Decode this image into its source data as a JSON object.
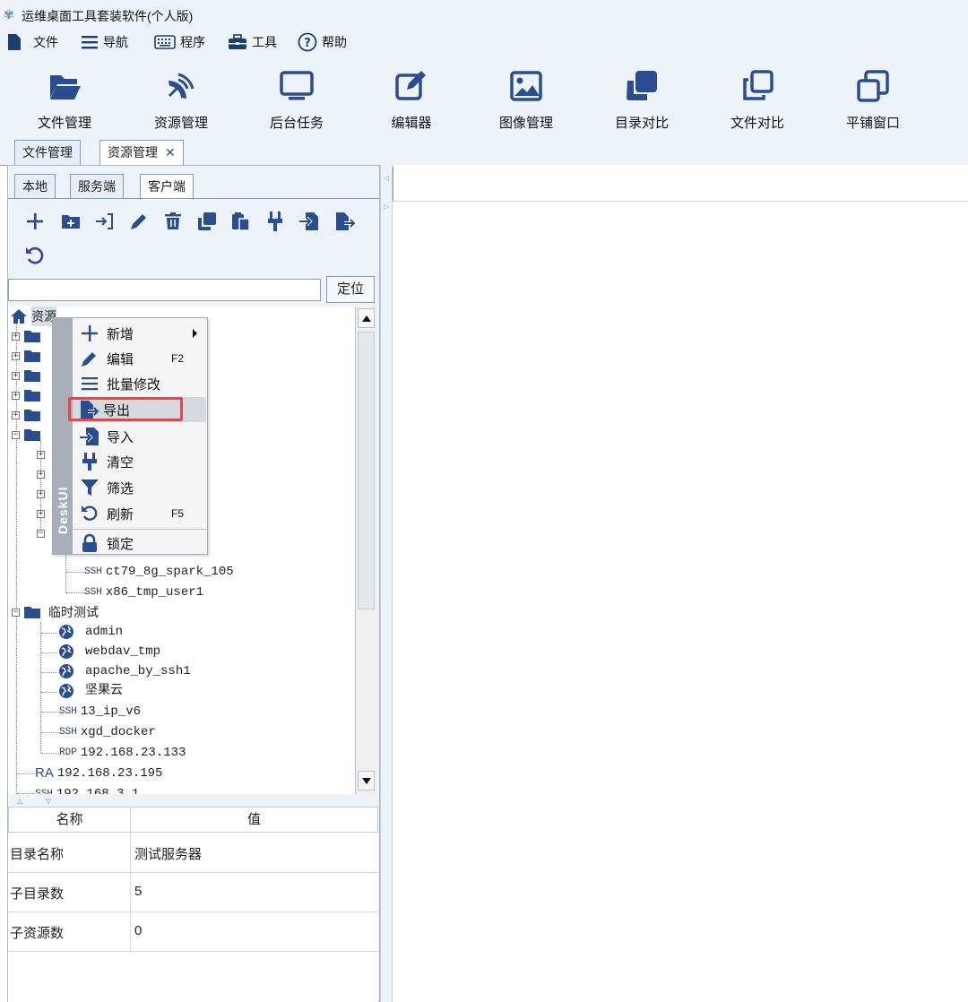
{
  "window": {
    "title": "运维桌面工具套装软件(个人版)"
  },
  "menubar": [
    {
      "label": "文件",
      "icon": "file-icon"
    },
    {
      "label": "导航",
      "icon": "hamburger-icon"
    },
    {
      "label": "程序",
      "icon": "keyboard-icon"
    },
    {
      "label": "工具",
      "icon": "toolbox-icon"
    },
    {
      "label": "帮助",
      "icon": "help-icon"
    }
  ],
  "toolbar": [
    {
      "label": "文件管理",
      "icon": "folder-open-icon"
    },
    {
      "label": "资源管理",
      "icon": "satellite-icon"
    },
    {
      "label": "后台任务",
      "icon": "monitor-icon"
    },
    {
      "label": "编辑器",
      "icon": "edit-icon"
    },
    {
      "label": "图像管理",
      "icon": "image-icon"
    },
    {
      "label": "目录对比",
      "icon": "copy-solid-icon"
    },
    {
      "label": "文件对比",
      "icon": "copy-outline-icon"
    },
    {
      "label": "平铺窗口",
      "icon": "window-restore-icon"
    }
  ],
  "top_tabs": [
    {
      "label": "文件管理",
      "active": false
    },
    {
      "label": "资源管理",
      "active": true,
      "close": "✕"
    }
  ],
  "sub_tabs": [
    {
      "label": "本地",
      "active": false
    },
    {
      "label": "服务端",
      "active": false
    },
    {
      "label": "客户端",
      "active": true
    }
  ],
  "locate_button": "定位",
  "search": {
    "value": "",
    "placeholder": ""
  },
  "tree": {
    "root": "资源",
    "items": [
      {
        "tag": "SSH",
        "label": "ct79_8g_spark_105"
      },
      {
        "tag": "SSH",
        "label": "x86_tmp_user1"
      },
      {
        "folder": "临时测试"
      },
      {
        "tag": "web",
        "label": "admin"
      },
      {
        "tag": "web",
        "label": "webdav_tmp"
      },
      {
        "tag": "web",
        "label": "apache_by_ssh1"
      },
      {
        "tag": "web",
        "label": "坚果云"
      },
      {
        "tag": "SSH",
        "label": "13_ip_v6"
      },
      {
        "tag": "SSH",
        "label": "xgd_docker"
      },
      {
        "tag": "RDP",
        "label": "192.168.23.133"
      },
      {
        "tag": "RA",
        "label": "192.168.23.195"
      },
      {
        "tag": "SSH",
        "label": "192.168.3.1"
      }
    ],
    "partial_label": "xgd"
  },
  "context_menu": {
    "brand": "DeskUI",
    "items": [
      {
        "label": "新增",
        "icon": "plus-icon",
        "submenu": true
      },
      {
        "label": "编辑",
        "icon": "pencil-icon",
        "shortcut": "F2"
      },
      {
        "label": "批量修改",
        "icon": "list-icon"
      },
      {
        "label": "导出",
        "icon": "export-icon",
        "highlighted": true
      },
      {
        "label": "导入",
        "icon": "import-icon"
      },
      {
        "label": "清空",
        "icon": "brush-icon"
      },
      {
        "label": "筛选",
        "icon": "filter-icon"
      },
      {
        "label": "刷新",
        "icon": "refresh-icon",
        "shortcut": "F5"
      },
      {
        "label": "锁定",
        "icon": "lock-icon"
      }
    ]
  },
  "properties": {
    "headers": [
      "名称",
      "值"
    ],
    "rows": [
      {
        "name": "目录名称",
        "value": "测试服务器"
      },
      {
        "name": "子目录数",
        "value": "5"
      },
      {
        "name": "子资源数",
        "value": "0"
      }
    ]
  },
  "colors": {
    "accent": "#2a4d8f",
    "highlight_box": "#e4464b",
    "chrome_bg": "#eef3fa"
  }
}
